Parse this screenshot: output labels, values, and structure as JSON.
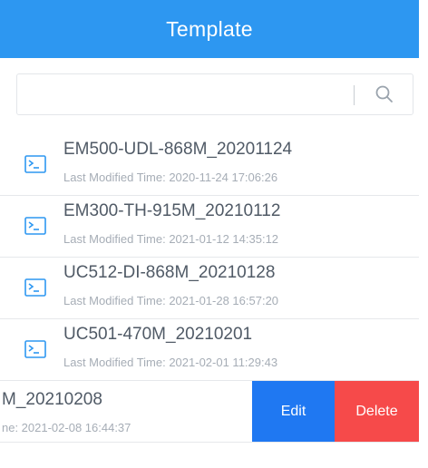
{
  "header": {
    "title": "Template"
  },
  "search": {
    "placeholder": ""
  },
  "templates": [
    {
      "name": "EM500-UDL-868M_20201124",
      "time": "Last Modified Time: 2020-11-24 17:06:26"
    },
    {
      "name": "EM300-TH-915M_20210112",
      "time": "Last Modified Time: 2021-01-12 14:35:12"
    },
    {
      "name": "UC512-DI-868M_20210128",
      "time": "Last Modified Time: 2021-01-28 16:57:20"
    },
    {
      "name": "UC501-470M_20210201",
      "time": "Last Modified Time: 2021-02-01 11:29:43"
    }
  ],
  "swiped_row": {
    "name": "M_20210208",
    "time": "ne: 2021-02-08 16:44:37",
    "edit_label": "Edit",
    "delete_label": "Delete"
  },
  "icons": {
    "search": "search-icon",
    "file": "terminal-file-icon"
  },
  "colors": {
    "header": "#2d97f1",
    "edit": "#1f78f2",
    "delete": "#f64a4a"
  }
}
